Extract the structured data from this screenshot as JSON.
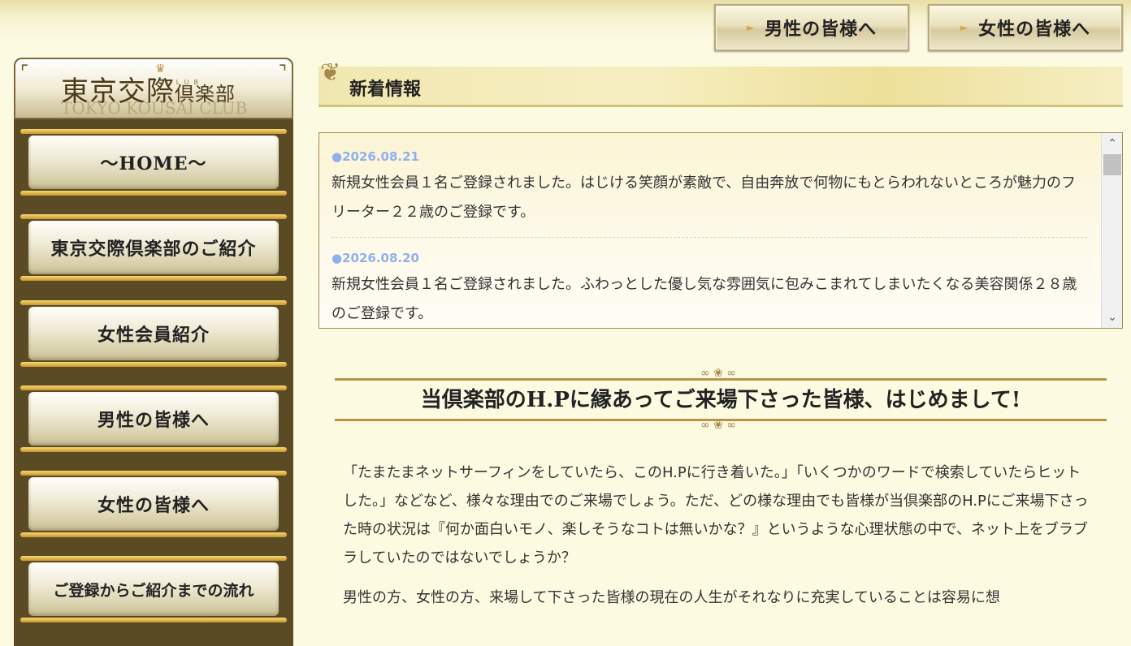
{
  "header": {
    "buttons": [
      {
        "label": "男性の皆様へ"
      },
      {
        "label": "女性の皆様へ"
      }
    ]
  },
  "logo": {
    "title_main": "東京交際",
    "title_small": "倶楽部",
    "club": "CLUB",
    "subtitle": "TOKYO KOUSAI CLUB"
  },
  "sidebar": {
    "items": [
      {
        "label": "～HOME～"
      },
      {
        "label": "東京交際倶楽部のご紹介"
      },
      {
        "label": "女性会員紹介"
      },
      {
        "label": "男性の皆様へ"
      },
      {
        "label": "女性の皆様へ"
      },
      {
        "label": "ご登録からご紹介までの流れ"
      }
    ]
  },
  "news": {
    "heading": "新着情報",
    "items": [
      {
        "date": "●2026.08.21",
        "text": "新規女性会員１名ご登録されました。はじける笑顔が素敵で、自由奔放で何物にもとらわれないところが魅力のフリーター２２歳のご登録です。"
      },
      {
        "date": "●2026.08.20",
        "text": "新規女性会員１名ご登録されました。ふわっとした優し気な雰囲気に包みこまれてしまいたくなる美容関係２８歳のご登録です。"
      }
    ]
  },
  "intro": {
    "banner": "当倶楽部のH.Pに縁あってご来場下さった皆様、はじめまして!",
    "paragraph1": "「たまたまネットサーフィンをしていたら、このH.Pに行き着いた。」「いくつかのワードで検索していたらヒットした。」などなど、様々な理由でのご来場でしょう。ただ、どの様な理由でも皆様が当倶楽部のH.Pにご来場下さった時の状況は『何か面白いモノ、楽しそうなコトは無いかな？』というような心理状態の中で、ネット上をブラブラしていたのではないでしょうか？",
    "paragraph2": "男性の方、女性の方、来場して下さった皆様の現在の人生がそれなりに充実していることは容易に想"
  }
}
